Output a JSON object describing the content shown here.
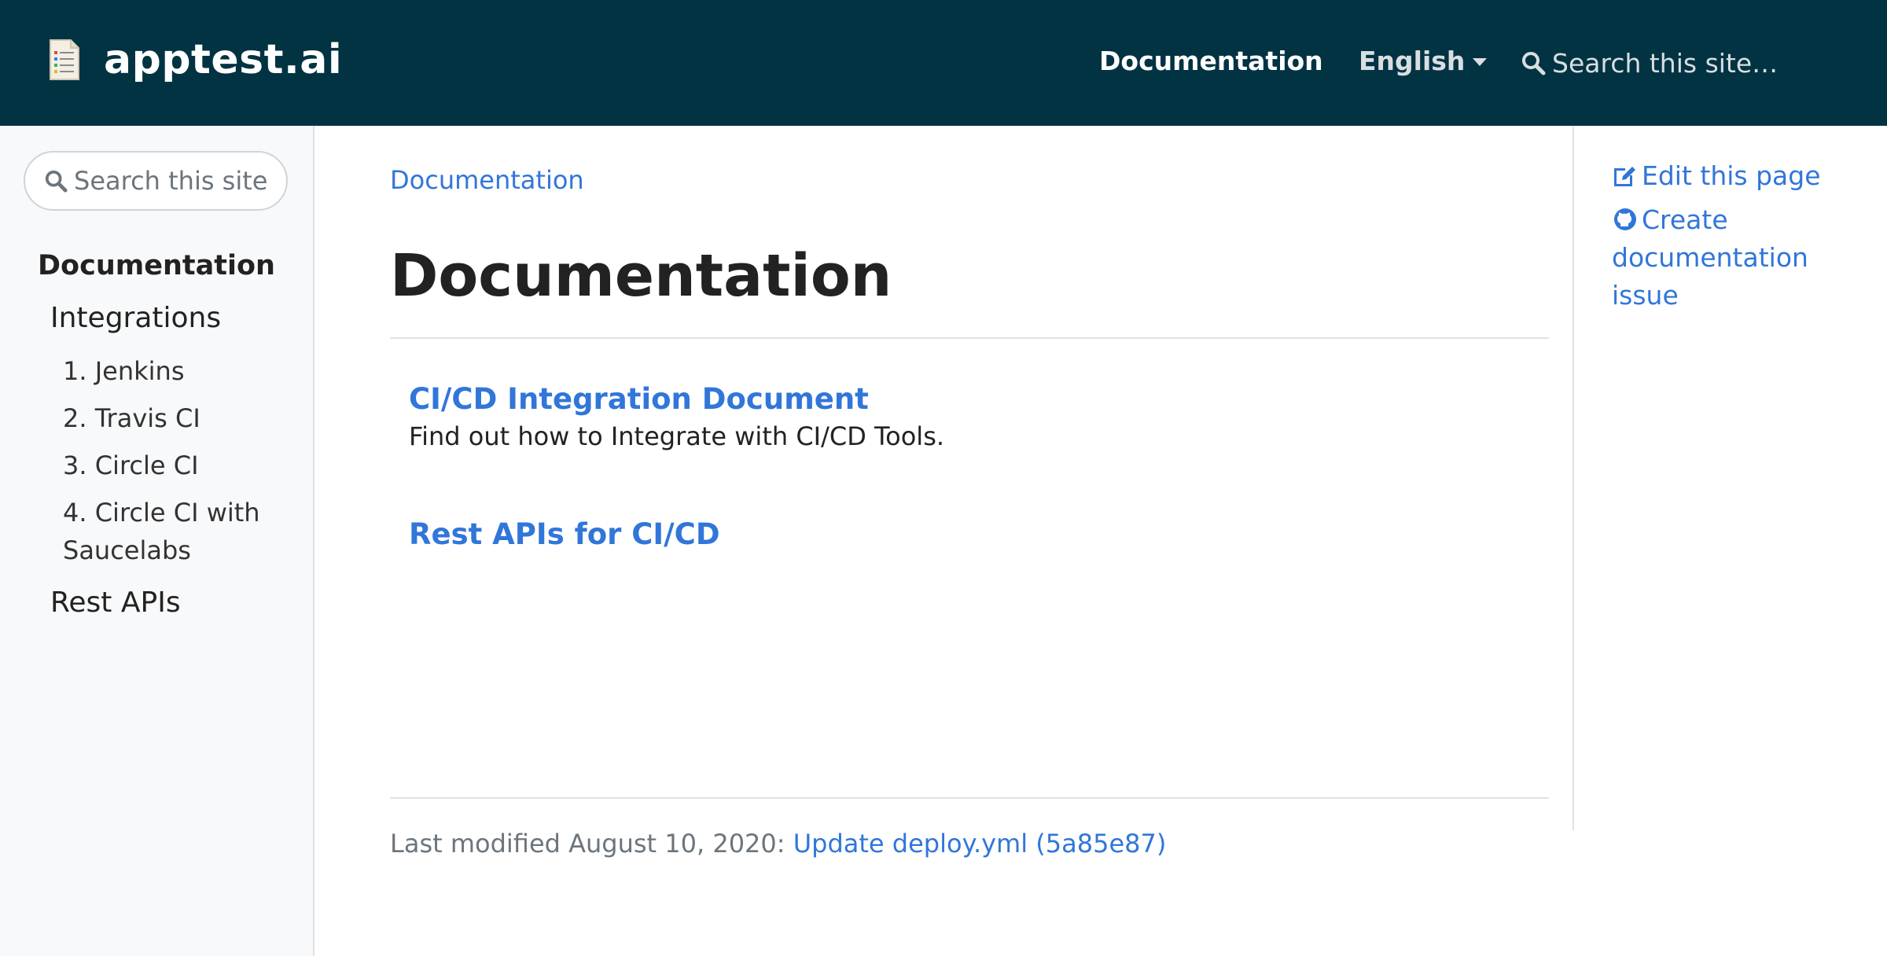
{
  "navbar": {
    "brand": "apptest.ai",
    "logo_icon": "document-list-icon",
    "links": {
      "documentation": "Documentation",
      "language": "English"
    },
    "search": {
      "placeholder": "Search this site…",
      "icon": "search-icon"
    }
  },
  "sidebar": {
    "search": {
      "placeholder": "Search this site…",
      "icon": "search-icon"
    },
    "section_title": "Documentation",
    "items": [
      {
        "label": "Integrations",
        "children": [
          {
            "label": "1. Jenkins"
          },
          {
            "label": "2. Travis CI"
          },
          {
            "label": "3. Circle CI"
          },
          {
            "label": "4. Circle CI with Saucelabs"
          }
        ]
      },
      {
        "label": "Rest APIs"
      }
    ]
  },
  "main": {
    "breadcrumb": "Documentation",
    "title": "Documentation",
    "entries": [
      {
        "title": "CI/CD Integration Document",
        "description": "Find out how to Integrate with CI/CD Tools."
      },
      {
        "title": "Rest APIs for CI/CD",
        "description": ""
      }
    ],
    "last_modified": {
      "prefix": "Last modified August 10, 2020: ",
      "link": "Update deploy.yml (5a85e87)"
    }
  },
  "toc": {
    "edit": {
      "label": "Edit this page",
      "icon": "edit-icon"
    },
    "issue": {
      "label": "Create documentation issue",
      "icon": "github-icon"
    }
  },
  "colors": {
    "navbar_bg": "#023343",
    "link": "#3176d9",
    "sidebar_bg": "#f8f9fa",
    "text": "#222222",
    "muted": "#6c757d"
  }
}
